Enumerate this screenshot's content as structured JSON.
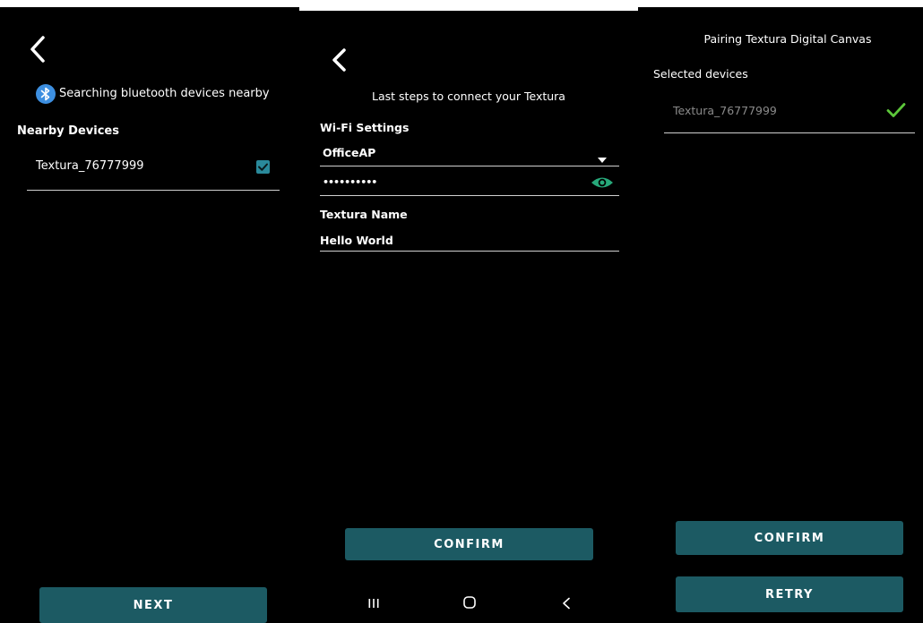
{
  "screen1": {
    "status": "Searching bluetooth devices nearby",
    "section_title": "Nearby Devices",
    "device_name": "Textura_76777999",
    "next_label": "NEXT"
  },
  "screen2": {
    "header": "Last steps to connect your Textura",
    "wifi_title": "Wi-Fi Settings",
    "network_value": "OfficeAP",
    "password_value": "••••••••••",
    "name_title": "Textura Name",
    "name_value": "Hello World",
    "confirm_label": "CONFIRM"
  },
  "screen3": {
    "title": "Pairing Textura Digital Canvas",
    "selected_title": "Selected devices",
    "device_name": "Textura_76777999",
    "confirm_label": "CONFIRM",
    "retry_label": "RETRY"
  },
  "colors": {
    "background": "#000000",
    "button": "#1c5a63",
    "accent_teal": "#2a8a9b",
    "eye_green": "#27a87a",
    "check_green": "#5cc73a",
    "bluetooth_blue": "#3d8fe0"
  }
}
